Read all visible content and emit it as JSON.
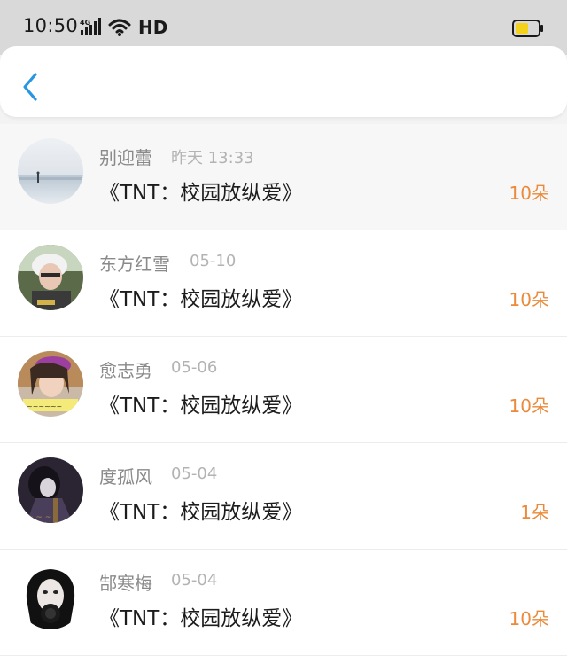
{
  "status_bar": {
    "time": "10:50",
    "network": "HD",
    "battery_color": "#f2d21a"
  },
  "nav": {
    "accent": "#2a95e0"
  },
  "gifts": [
    {
      "name": "别迎蕾",
      "date": "昨天 13:33",
      "title": "《TNT：校园放纵爱》",
      "count": "10朵"
    },
    {
      "name": "东方红雪",
      "date": "05-10",
      "title": "《TNT：校园放纵爱》",
      "count": "10朵"
    },
    {
      "name": "愈志勇",
      "date": "05-06",
      "title": "《TNT：校园放纵爱》",
      "count": "10朵"
    },
    {
      "name": "度孤风",
      "date": "05-04",
      "title": "《TNT：校园放纵爱》",
      "count": "1朵"
    },
    {
      "name": "郜寒梅",
      "date": "05-04",
      "title": "《TNT：校园放纵爱》",
      "count": "10朵"
    }
  ]
}
